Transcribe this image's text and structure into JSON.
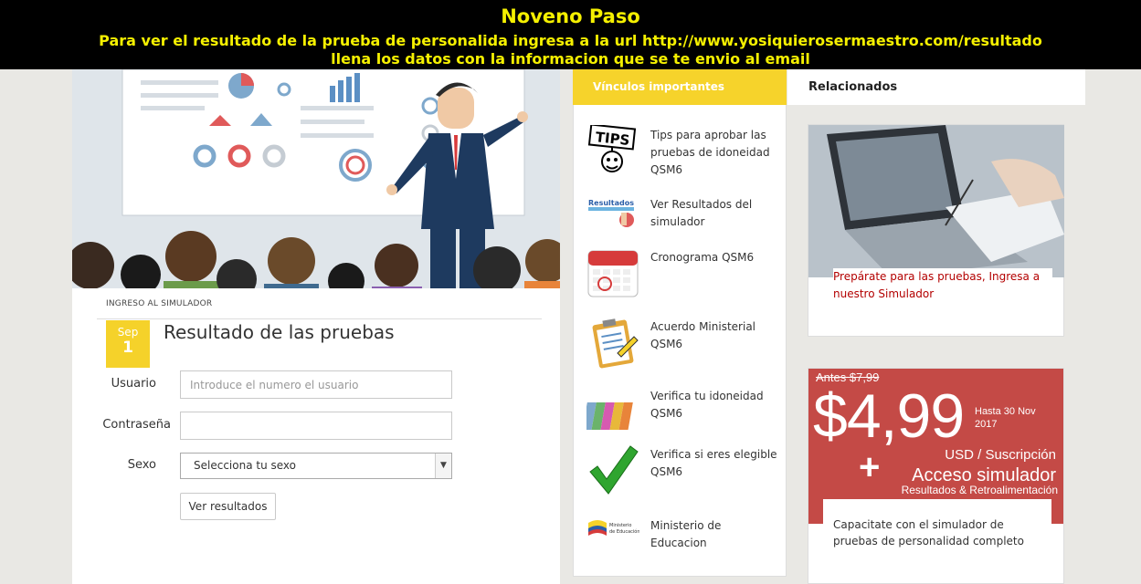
{
  "banner": {
    "title": "Noveno Paso",
    "line1": "Para ver el resultado de la prueba de personalida ingresa a la url  http://www.yosiquierosermaestro.com/resultado",
    "line2": "llena los datos con la informacion que se te envio al email"
  },
  "form": {
    "tag": "INGRESO AL SIMULADOR",
    "date_month": "Sep",
    "date_day": "1",
    "title": "Resultado de las pruebas",
    "usuario_label": "Usuario",
    "usuario_placeholder": "Introduce el numero el usuario",
    "password_label": "Contraseña",
    "password_value": "",
    "sexo_label": "Sexo",
    "sexo_selected": "Selecciona tu sexo",
    "submit_label": "Ver resultados"
  },
  "links": {
    "tab_label": "Vínculos importantes",
    "items": [
      {
        "label": "Tips para aprobar las pruebas de idoneidad QSM6",
        "icon": "tips-icon"
      },
      {
        "label": "Ver Resultados del simulador",
        "icon": "resultados-icon"
      },
      {
        "label": "Cronograma QSM6",
        "icon": "calendar-icon"
      },
      {
        "label": "Acuerdo Ministerial QSM6",
        "icon": "clipboard-icon"
      },
      {
        "label": "Verifica tu idoneidad QSM6",
        "icon": "folders-icon"
      },
      {
        "label": "Verifica si eres elegible QSM6",
        "icon": "checkmark-icon"
      },
      {
        "label": "Ministerio de Educacion",
        "icon": "ministerio-logo-icon"
      }
    ],
    "resultados_icon_text": "Resultados",
    "ministerio_logo_text": "Ministerio de Educación"
  },
  "related": {
    "tab_label": "Relacionados",
    "card1_caption": "Prepárate para las pruebas, Ingresa a nuestro Simulador",
    "card2_caption": "Capacitate con el simulador de pruebas de personalidad completo",
    "promo": {
      "antes": "Antes $7,99",
      "price": "$4,99",
      "hasta": "Hasta 30 Nov 2017",
      "usd": "USD / Suscripción",
      "plus": "+",
      "acceso": "Acceso simulador",
      "retro": "Resultados & Retroalimentación"
    }
  },
  "colors": {
    "accent_yellow": "#f6d32b",
    "banner_text": "#f5f000",
    "promo_red": "#c44a46",
    "link_red": "#b30000"
  }
}
